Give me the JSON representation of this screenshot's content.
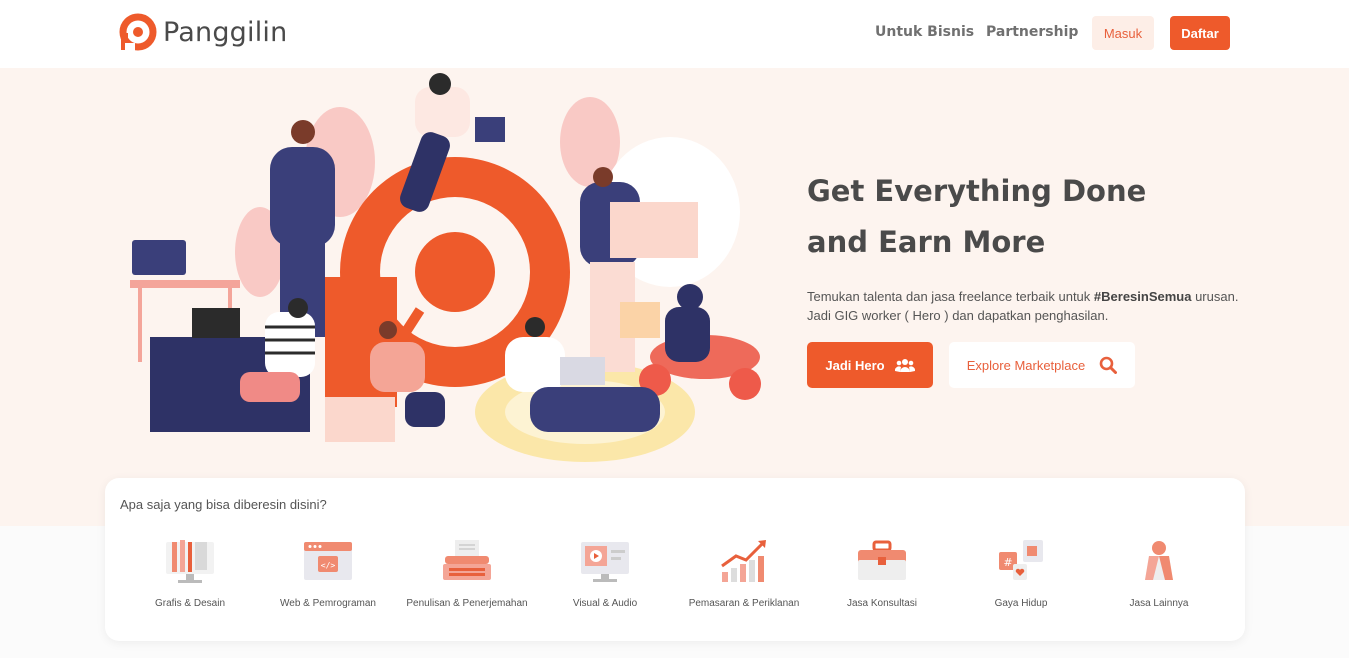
{
  "brand": {
    "name": "Panggilin",
    "accent": "#ee5a2b"
  },
  "nav": {
    "links": [
      "Untuk Bisnis",
      "Partnership"
    ],
    "login": "Masuk",
    "register": "Daftar"
  },
  "hero": {
    "title_line1": "Get Everything Done",
    "title_line2": "and Earn More",
    "desc_line1_pre": "Temukan talenta dan jasa freelance terbaik untuk ",
    "desc_hashtag": "#BeresinSemua",
    "desc_line1_post": " urusan.",
    "desc_line2": "Jadi GIG worker ( Hero ) dan dapatkan penghasilan.",
    "btn_primary": "Jadi Hero",
    "btn_primary_icon": "users-icon",
    "btn_secondary": "Explore Marketplace",
    "btn_secondary_icon": "search-icon"
  },
  "categories": {
    "title": "Apa saja yang bisa diberesin disini?",
    "items": [
      {
        "label": "Grafis & Desain",
        "icon": "design-icon"
      },
      {
        "label": "Web & Pemrograman",
        "icon": "code-icon"
      },
      {
        "label": "Penulisan & Penerjemahan",
        "icon": "typewriter-icon"
      },
      {
        "label": "Visual & Audio",
        "icon": "video-icon"
      },
      {
        "label": "Pemasaran & Periklanan",
        "icon": "growth-chart-icon"
      },
      {
        "label": "Jasa Konsultasi",
        "icon": "briefcase-icon"
      },
      {
        "label": "Gaya Hidup",
        "icon": "social-icon"
      },
      {
        "label": "Jasa Lainnya",
        "icon": "hooded-figure-icon"
      }
    ]
  }
}
